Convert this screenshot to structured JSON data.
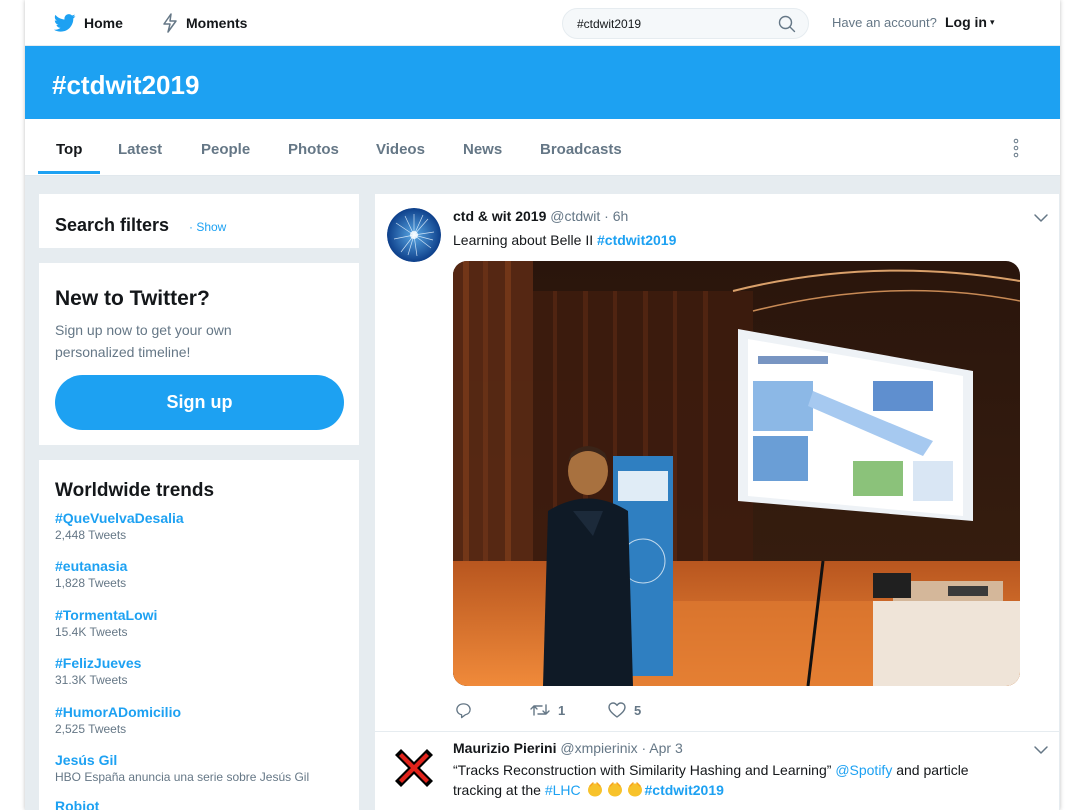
{
  "topnav": {
    "home_label": "Home",
    "moments_label": "Moments",
    "search_value": "#ctdwit2019",
    "account_prompt": "Have an account?",
    "login_label": "Log in",
    "login_caret": "▾"
  },
  "banner": {
    "title": "#ctdwit2019"
  },
  "tabs": [
    {
      "label": "Top",
      "active": true
    },
    {
      "label": "Latest"
    },
    {
      "label": "People"
    },
    {
      "label": "Photos"
    },
    {
      "label": "Videos"
    },
    {
      "label": "News"
    },
    {
      "label": "Broadcasts"
    }
  ],
  "filters": {
    "title": "Search filters",
    "show_label": "· Show"
  },
  "signup": {
    "title": "New to Twitter?",
    "description": "Sign up now to get your own personalized timeline!",
    "button_label": "Sign up"
  },
  "trends": {
    "title": "Worldwide trends",
    "items": [
      {
        "name": "#QueVuelvaDesalia",
        "meta": "2,448 Tweets"
      },
      {
        "name": "#eutanasia",
        "meta": "1,828 Tweets"
      },
      {
        "name": "#TormentaLowi",
        "meta": "15.4K Tweets"
      },
      {
        "name": "#FelizJueves",
        "meta": "31.3K Tweets"
      },
      {
        "name": "#HumorADomicilio",
        "meta": "2,525 Tweets"
      },
      {
        "name": "Jesús Gil",
        "meta": "HBO España anuncia una serie sobre Jesús Gil"
      },
      {
        "name": "Robiot",
        "meta": ""
      }
    ]
  },
  "tweets": [
    {
      "name": "ctd & wit 2019",
      "handle": "@ctdwit",
      "separator": "·",
      "time": "6h",
      "text_prefix": "Learning about Belle II ",
      "text_hashtag": "#ctdwit2019",
      "reply_count": "",
      "retweet_count": "1",
      "like_count": "5"
    },
    {
      "name": "Maurizio Pierini",
      "handle": "@xmpierinix",
      "separator": "·",
      "time": "Apr 3",
      "text_part1": "“Tracks Reconstruction with Similarity Hashing and Learning” ",
      "text_mention": "@Spotify",
      "text_part2": " and particle tracking at the ",
      "text_hashtag1": "#LHC",
      "text_hashtag2": "#ctdwit2019"
    }
  ],
  "colors": {
    "accent": "#1da1f2",
    "text_primary": "#14171a",
    "text_secondary": "#657786",
    "background": "#e6ecf0"
  },
  "icons": {
    "home": "twitter-bird-icon",
    "moments": "lightning-icon",
    "search": "search-icon",
    "more": "vertical-dots-icon",
    "chevron": "chevron-down-icon",
    "reply": "reply-icon",
    "retweet": "retweet-icon",
    "like": "heart-icon",
    "emoji": "clapping-hands-emoji",
    "avatar2": "red-x-icon"
  }
}
